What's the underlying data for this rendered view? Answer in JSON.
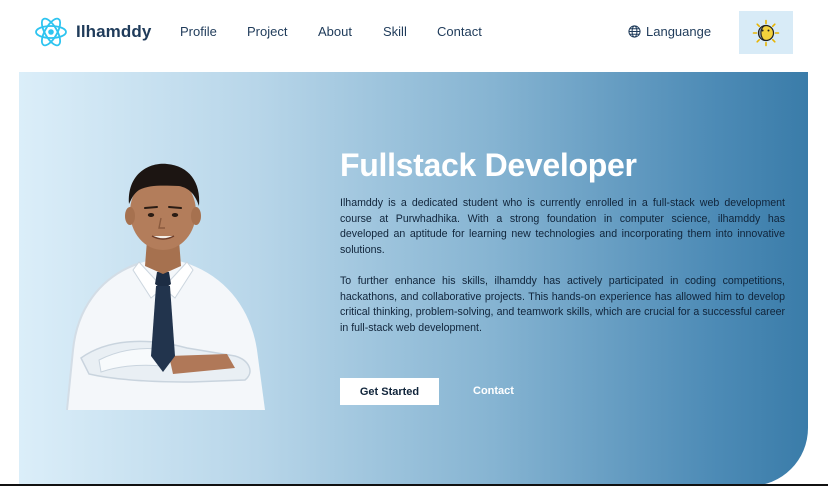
{
  "brand": {
    "name": "Ilhamddy",
    "logo_icon": "react-atom-icon",
    "accent": "#2ec4f0"
  },
  "nav": {
    "items": [
      {
        "label": "Profile"
      },
      {
        "label": "Project"
      },
      {
        "label": "About"
      },
      {
        "label": "Skill"
      },
      {
        "label": "Contact"
      }
    ],
    "language_label": "Languange",
    "language_icon": "globe-icon",
    "theme_toggle_icon": "sun-moon-icon"
  },
  "hero": {
    "title": "Fullstack Developer",
    "paragraphs": [
      "Ilhamddy is a dedicated student who is currently enrolled in a full-stack web development course at Purwhadhika. With a strong foundation in computer science, ilhamddy has developed an aptitude for learning new technologies and incorporating them into innovative solutions.",
      "To further enhance his skills, ilhamddy has actively participated in coding competitions, hackathons, and collaborative projects. This hands-on experience has allowed him to develop critical thinking, problem-solving, and teamwork skills, which are crucial for a successful career in full-stack web development."
    ],
    "primary_button": "Get Started",
    "secondary_link": "Contact",
    "gradient_start": "#dbeef9",
    "gradient_end": "#3a7ca9"
  }
}
